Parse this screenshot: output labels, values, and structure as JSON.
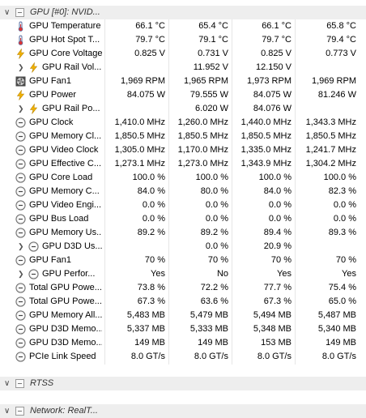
{
  "groups": {
    "gpu": "GPU [#0]: NVID...",
    "rtss": "RTSS",
    "network": "Network: RealT..."
  },
  "rows": [
    {
      "label": "GPU Temperature",
      "icon": "thermometer-icon",
      "indent": false,
      "chevron": false,
      "v": [
        "66.1 °C",
        "65.4 °C",
        "66.1 °C",
        "65.8 °C"
      ]
    },
    {
      "label": "GPU Hot Spot T...",
      "icon": "thermometer-icon",
      "indent": false,
      "chevron": false,
      "v": [
        "79.7 °C",
        "79.1 °C",
        "79.7 °C",
        "79.4 °C"
      ]
    },
    {
      "label": "GPU Core Voltage",
      "icon": "lightning-icon",
      "indent": false,
      "chevron": false,
      "v": [
        "0.825 V",
        "0.731 V",
        "0.825 V",
        "0.773 V"
      ]
    },
    {
      "label": "GPU Rail Vol...",
      "icon": "lightning-icon",
      "indent": true,
      "chevron": true,
      "v": [
        "",
        "11.952 V",
        "12.150 V",
        ""
      ]
    },
    {
      "label": "GPU Fan1",
      "icon": "fan-icon",
      "indent": false,
      "chevron": false,
      "v": [
        "1,969 RPM",
        "1,965 RPM",
        "1,973 RPM",
        "1,969 RPM"
      ]
    },
    {
      "label": "GPU Power",
      "icon": "lightning-icon",
      "indent": false,
      "chevron": false,
      "v": [
        "84.075 W",
        "79.555 W",
        "84.075 W",
        "81.246 W"
      ]
    },
    {
      "label": "GPU Rail Po...",
      "icon": "lightning-icon",
      "indent": true,
      "chevron": true,
      "v": [
        "",
        "6.020 W",
        "84.076 W",
        ""
      ]
    },
    {
      "label": "GPU Clock",
      "icon": "clock-icon",
      "indent": false,
      "chevron": false,
      "v": [
        "1,410.0 MHz",
        "1,260.0 MHz",
        "1,440.0 MHz",
        "1,343.3 MHz"
      ]
    },
    {
      "label": "GPU Memory Cl...",
      "icon": "clock-icon",
      "indent": false,
      "chevron": false,
      "v": [
        "1,850.5 MHz",
        "1,850.5 MHz",
        "1,850.5 MHz",
        "1,850.5 MHz"
      ]
    },
    {
      "label": "GPU Video Clock",
      "icon": "clock-icon",
      "indent": false,
      "chevron": false,
      "v": [
        "1,305.0 MHz",
        "1,170.0 MHz",
        "1,335.0 MHz",
        "1,241.7 MHz"
      ]
    },
    {
      "label": "GPU Effective C...",
      "icon": "clock-icon",
      "indent": false,
      "chevron": false,
      "v": [
        "1,273.1 MHz",
        "1,273.0 MHz",
        "1,343.9 MHz",
        "1,304.2 MHz"
      ]
    },
    {
      "label": "GPU Core Load",
      "icon": "gauge-icon",
      "indent": false,
      "chevron": false,
      "v": [
        "100.0 %",
        "100.0 %",
        "100.0 %",
        "100.0 %"
      ]
    },
    {
      "label": "GPU Memory C...",
      "icon": "gauge-icon",
      "indent": false,
      "chevron": false,
      "v": [
        "84.0 %",
        "80.0 %",
        "84.0 %",
        "82.3 %"
      ]
    },
    {
      "label": "GPU Video Engi...",
      "icon": "gauge-icon",
      "indent": false,
      "chevron": false,
      "v": [
        "0.0 %",
        "0.0 %",
        "0.0 %",
        "0.0 %"
      ]
    },
    {
      "label": "GPU Bus Load",
      "icon": "gauge-icon",
      "indent": false,
      "chevron": false,
      "v": [
        "0.0 %",
        "0.0 %",
        "0.0 %",
        "0.0 %"
      ]
    },
    {
      "label": "GPU Memory Us...",
      "icon": "gauge-icon",
      "indent": false,
      "chevron": false,
      "v": [
        "89.2 %",
        "89.2 %",
        "89.4 %",
        "89.3 %"
      ]
    },
    {
      "label": "GPU D3D Us...",
      "icon": "gauge-icon",
      "indent": true,
      "chevron": true,
      "v": [
        "",
        "0.0 %",
        "20.9 %",
        ""
      ]
    },
    {
      "label": "GPU Fan1",
      "icon": "gauge-icon",
      "indent": false,
      "chevron": false,
      "v": [
        "70 %",
        "70 %",
        "70 %",
        "70 %"
      ]
    },
    {
      "label": "GPU Perfor...",
      "icon": "gauge-icon",
      "indent": true,
      "chevron": true,
      "v": [
        "Yes",
        "No",
        "Yes",
        "Yes"
      ]
    },
    {
      "label": "Total GPU Powe...",
      "icon": "gauge-icon",
      "indent": false,
      "chevron": false,
      "v": [
        "73.8 %",
        "72.2 %",
        "77.7 %",
        "75.4 %"
      ]
    },
    {
      "label": "Total GPU Powe...",
      "icon": "gauge-icon",
      "indent": false,
      "chevron": false,
      "v": [
        "67.3 %",
        "63.6 %",
        "67.3 %",
        "65.0 %"
      ]
    },
    {
      "label": "GPU Memory All...",
      "icon": "gauge-icon",
      "indent": false,
      "chevron": false,
      "v": [
        "5,483 MB",
        "5,479 MB",
        "5,494 MB",
        "5,487 MB"
      ]
    },
    {
      "label": "GPU D3D Memo...",
      "icon": "gauge-icon",
      "indent": false,
      "chevron": false,
      "v": [
        "5,337 MB",
        "5,333 MB",
        "5,348 MB",
        "5,340 MB"
      ]
    },
    {
      "label": "GPU D3D Memo...",
      "icon": "gauge-icon",
      "indent": false,
      "chevron": false,
      "v": [
        "149 MB",
        "149 MB",
        "153 MB",
        "149 MB"
      ]
    },
    {
      "label": "PCIe Link Speed",
      "icon": "gauge-icon",
      "indent": false,
      "chevron": false,
      "v": [
        "8.0 GT/s",
        "8.0 GT/s",
        "8.0 GT/s",
        "8.0 GT/s"
      ]
    }
  ]
}
